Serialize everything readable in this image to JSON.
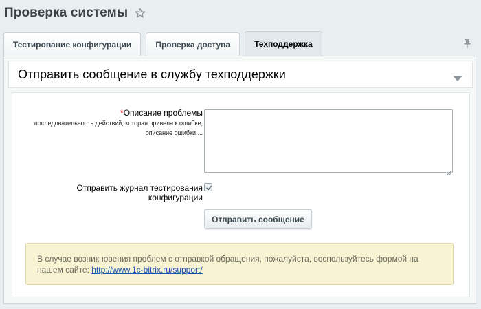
{
  "page": {
    "title": "Проверка системы",
    "icons": {
      "favorite": "star-outline-icon",
      "pin": "pin-icon"
    }
  },
  "tabs": [
    {
      "label": "Тестирование конфигурации",
      "active": false
    },
    {
      "label": "Проверка доступа",
      "active": false
    },
    {
      "label": "Техподдержка",
      "active": true
    }
  ],
  "section": {
    "title": "Отправить сообщение в службу техподдержки",
    "collapse_icon": "triangle-down-icon"
  },
  "form": {
    "problem_field": {
      "required_mark": "*",
      "label": "Описание проблемы",
      "hint": "последовательность действий, которая привела к ошибке, описание ошибки,...",
      "value": ""
    },
    "send_log": {
      "label": "Отправить журнал тестирования конфигурации",
      "checked": true
    },
    "submit_label": "Отправить сообщение"
  },
  "notice": {
    "text": "В случае возникновения проблем с отправкой обращения, пожалуйста, воспользуйтесь формой на нашем сайте:",
    "link_text": "http://www.1c-bitrix.ru/support/"
  },
  "colors": {
    "background": "#e9eef1",
    "notice_bg": "#f8f3d2",
    "link": "#1a53b0",
    "required": "#dd0000"
  }
}
